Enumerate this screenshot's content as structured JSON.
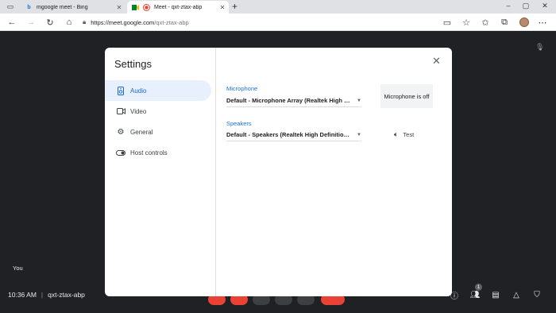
{
  "browser": {
    "tabs": [
      {
        "title": "mgoogle meet - Bing",
        "favicon": "bing-icon"
      },
      {
        "title": "Meet - qxt-ztax-abp",
        "favicon": "meet-icon"
      }
    ],
    "url_host": "https://meet.google.com",
    "url_path": "/qxt-ztax-abp"
  },
  "meet": {
    "self_label": "You",
    "time": "10:36 AM",
    "separator": "|",
    "meeting_code": "qxt-ztax-abp",
    "participants_count": "1"
  },
  "settings": {
    "title": "Settings",
    "menu": [
      {
        "label": "Audio",
        "icon": "speaker-icon",
        "active": true
      },
      {
        "label": "Video",
        "icon": "video-icon",
        "active": false
      },
      {
        "label": "General",
        "icon": "gear-icon",
        "active": false
      },
      {
        "label": "Host controls",
        "icon": "toggle-icon",
        "active": false
      }
    ],
    "microphone": {
      "label": "Microphone",
      "value": "Default - Microphone Array (Realtek High Definition Audio)",
      "status": "Microphone is off"
    },
    "speakers": {
      "label": "Speakers",
      "value": "Default - Speakers (Realtek High Definition Audio)",
      "test_label": "Test"
    }
  },
  "colors": {
    "accent": "#1a73e8",
    "active_bg": "#e8f0fe",
    "meet_bg": "#202124",
    "end_call": "#ea4335"
  }
}
